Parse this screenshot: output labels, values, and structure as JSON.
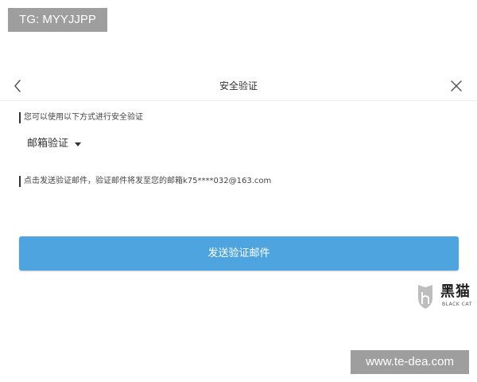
{
  "overlays": {
    "tg_badge": "TG: MYYJJPP",
    "url_badge": "www.te-dea.com",
    "watermark_title": "黑猫",
    "watermark_subtitle": "BLACK CAT"
  },
  "header": {
    "title": "安全验证",
    "back_icon": "chevron-left-icon",
    "close_icon": "close-icon"
  },
  "verification": {
    "methods_label": "您可以使用以下方式进行安全验证",
    "selected_method": "邮箱验证",
    "caret_icon": "caret-down-icon",
    "notice": "点击发送验证邮件，验证邮件将发至您的邮箱k75****032@163.com",
    "send_button_label": "发送验证邮件"
  },
  "colors": {
    "button": "#4ea4de",
    "overlay": "#9e9e9e"
  }
}
